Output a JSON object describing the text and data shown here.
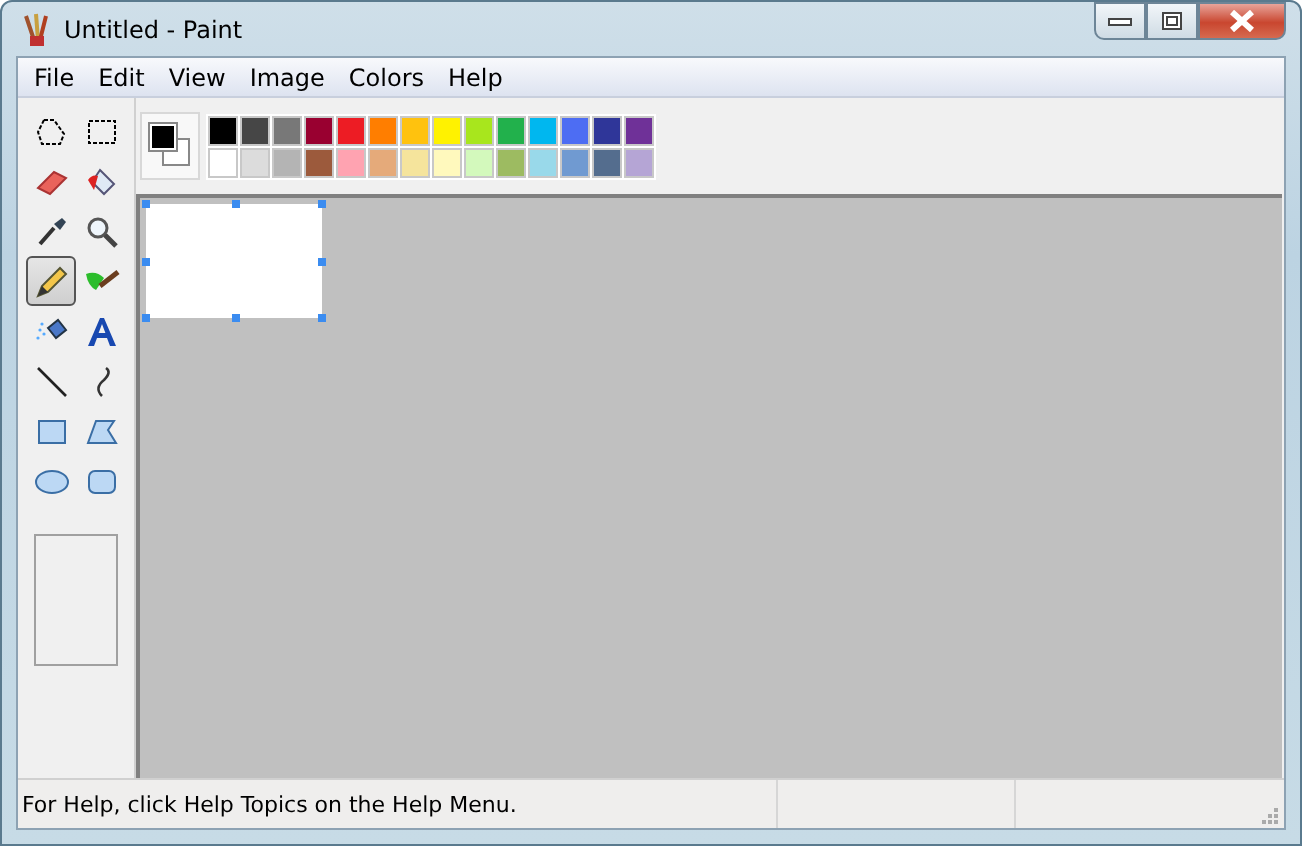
{
  "window": {
    "title": "Untitled - Paint"
  },
  "menu": [
    "File",
    "Edit",
    "View",
    "Image",
    "Colors",
    "Help"
  ],
  "tools": [
    {
      "kind": "free-select",
      "selected": false
    },
    {
      "kind": "select",
      "selected": false
    },
    {
      "kind": "eraser",
      "selected": false
    },
    {
      "kind": "fill",
      "selected": false
    },
    {
      "kind": "picker",
      "selected": false
    },
    {
      "kind": "magnifier",
      "selected": false
    },
    {
      "kind": "pencil",
      "selected": true
    },
    {
      "kind": "brush",
      "selected": false
    },
    {
      "kind": "airbrush",
      "selected": false
    },
    {
      "kind": "text",
      "selected": false
    },
    {
      "kind": "line",
      "selected": false
    },
    {
      "kind": "curve",
      "selected": false
    },
    {
      "kind": "rectangle",
      "selected": false
    },
    {
      "kind": "polygon",
      "selected": false
    },
    {
      "kind": "ellipse",
      "selected": false
    },
    {
      "kind": "rounded-rectangle",
      "selected": false
    }
  ],
  "current_colors": {
    "foreground": {
      "color": "#000000"
    },
    "background": {
      "color": "#ffffff"
    }
  },
  "palette": [
    {
      "color": "#000000"
    },
    {
      "color": "#464646"
    },
    {
      "color": "#787878"
    },
    {
      "color": "#990030"
    },
    {
      "color": "#ed1c24"
    },
    {
      "color": "#ff7e00"
    },
    {
      "color": "#ffc20e"
    },
    {
      "color": "#fff200"
    },
    {
      "color": "#a8e61d"
    },
    {
      "color": "#22b14c"
    },
    {
      "color": "#00b7ef"
    },
    {
      "color": "#4d6df3"
    },
    {
      "color": "#2f3699"
    },
    {
      "color": "#6f3198"
    },
    {
      "color": "#ffffff"
    },
    {
      "color": "#dcdcdc"
    },
    {
      "color": "#b4b4b4"
    },
    {
      "color": "#9c5a3c"
    },
    {
      "color": "#ffa3b1"
    },
    {
      "color": "#e5aa7a"
    },
    {
      "color": "#f5e49c"
    },
    {
      "color": "#fff9bd"
    },
    {
      "color": "#d3f9bc"
    },
    {
      "color": "#9dbb61"
    },
    {
      "color": "#99d9ea"
    },
    {
      "color": "#709ad1"
    },
    {
      "color": "#546d8e"
    },
    {
      "color": "#b5a5d5"
    }
  ],
  "status_bar": {
    "text": "For Help, click Help Topics on the Help Menu."
  }
}
